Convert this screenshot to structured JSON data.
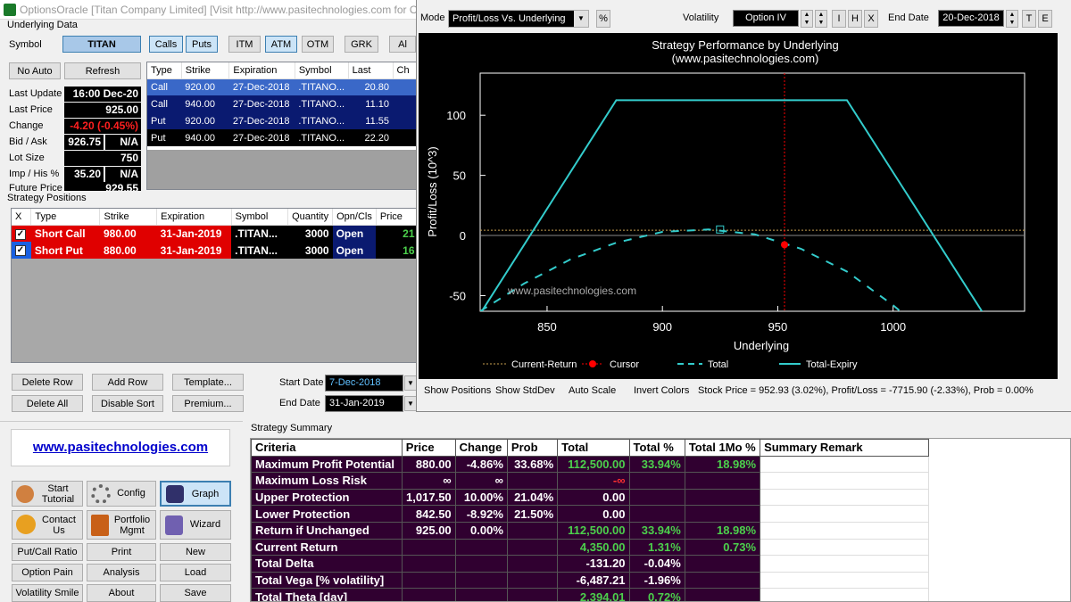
{
  "window": {
    "title": "OptionsOracle [Titan Company Limited]   [Visit  http://www.pasitechnologies.com  for O"
  },
  "underlying": {
    "group_label": "Underlying Data",
    "symbol_label": "Symbol",
    "symbol": "TITAN",
    "calls": "Calls",
    "puts": "Puts",
    "itm": "ITM",
    "atm": "ATM",
    "otm": "OTM",
    "grk": "GRK",
    "all": "Al",
    "no_auto": "No Auto",
    "refresh": "Refresh",
    "fields": [
      {
        "label": "Last Update",
        "value": "16:00 Dec-20"
      },
      {
        "label": "Last Price",
        "value": "925.00"
      },
      {
        "label": "Change",
        "value": "-4.20 (-0.45%)"
      },
      {
        "label": "Bid / Ask",
        "value": "926.75",
        "value2": "N/A"
      },
      {
        "label": "Lot Size",
        "value": "750"
      },
      {
        "label": "Imp / His %",
        "value": "35.20",
        "value2": "N/A"
      },
      {
        "label": "Future Price",
        "value": "929.55"
      }
    ]
  },
  "options_table": {
    "headers": [
      "Type",
      "Strike",
      "Expiration",
      "Symbol",
      "Last",
      "Ch"
    ],
    "rows": [
      {
        "type": "Call",
        "strike": "920.00",
        "expiration": "27-Dec-2018",
        "symbol": ".TITANO...",
        "last": "20.80"
      },
      {
        "type": "Call",
        "strike": "940.00",
        "expiration": "27-Dec-2018",
        "symbol": ".TITANO...",
        "last": "11.10"
      },
      {
        "type": "Put",
        "strike": "920.00",
        "expiration": "27-Dec-2018",
        "symbol": ".TITANO...",
        "last": "11.55"
      },
      {
        "type": "Put",
        "strike": "940.00",
        "expiration": "27-Dec-2018",
        "symbol": ".TITANO...",
        "last": "22.20"
      }
    ]
  },
  "positions": {
    "label": "Strategy Positions",
    "headers": [
      "X",
      "Type",
      "Strike",
      "Expiration",
      "Symbol",
      "Quantity",
      "Opn/Cls",
      "Price"
    ],
    "rows": [
      {
        "x": "✓",
        "type": "Short Call",
        "strike": "980.00",
        "expiration": "31-Jan-2019",
        "symbol": ".TITAN...",
        "quantity": "3000",
        "opn": "Open",
        "price": "21"
      },
      {
        "x": "✓",
        "type": "Short Put",
        "strike": "880.00",
        "expiration": "31-Jan-2019",
        "symbol": ".TITAN...",
        "quantity": "3000",
        "opn": "Open",
        "price": "16"
      }
    ]
  },
  "pos_buttons": {
    "delete_row": "Delete Row",
    "add_row": "Add Row",
    "template": "Template...",
    "delete_all": "Delete All",
    "disable_sort": "Disable Sort",
    "premium": "Premium...",
    "start_date_label": "Start Date",
    "start_date": "7-Dec-2018",
    "end_date_label": "End Date",
    "end_date": "31-Jan-2019"
  },
  "nav": {
    "link": "www.pasitechnologies.com",
    "start_tutorial": "Start Tutorial",
    "config": "Config",
    "graph": "Graph",
    "contact_us": "Contact Us",
    "portfolio": "Portfolio Mgmt",
    "wizard": "Wizard",
    "put_call_ratio": "Put/Call Ratio",
    "print": "Print",
    "new": "New",
    "option_pain": "Option Pain",
    "analysis": "Analysis",
    "load": "Load",
    "volatility_smile": "Volatility Smile",
    "about": "About",
    "save": "Save"
  },
  "summary": {
    "label": "Strategy Summary",
    "headers": [
      "Criteria",
      "Price",
      "Change",
      "Prob",
      "Total",
      "Total %",
      "Total 1Mo %",
      "Summary Remark"
    ],
    "rows": [
      [
        "Maximum Profit Potential",
        "880.00",
        "-4.86%",
        "33.68%",
        "112,500.00",
        "33.94%",
        "18.98%",
        ""
      ],
      [
        "Maximum Loss Risk",
        "∞",
        "∞",
        "",
        "-∞",
        "",
        "",
        ""
      ],
      [
        "Upper Protection",
        "1,017.50",
        "10.00%",
        "21.04%",
        "0.00",
        "",
        "",
        ""
      ],
      [
        "Lower Protection",
        "842.50",
        "-8.92%",
        "21.50%",
        "0.00",
        "",
        "",
        ""
      ],
      [
        "Return if Unchanged",
        "925.00",
        "0.00%",
        "",
        "112,500.00",
        "33.94%",
        "18.98%",
        ""
      ],
      [
        "Current Return",
        "",
        "",
        "",
        "4,350.00",
        "1.31%",
        "0.73%",
        ""
      ],
      [
        "Total Delta",
        "",
        "",
        "",
        "-131.20",
        "-0.04%",
        "",
        ""
      ],
      [
        "Total Vega [% volatility]",
        "",
        "",
        "",
        "-6,487.21",
        "-1.96%",
        "",
        ""
      ],
      [
        "Total Theta [day]",
        "",
        "",
        "",
        "2,394.01",
        "0.72%",
        "",
        ""
      ]
    ]
  },
  "graph": {
    "mode_label": "Mode",
    "mode": "Profit/Loss Vs. Underlying",
    "pct": "%",
    "vol_label": "Volatility",
    "vol": "Option IV",
    "i": "I",
    "h": "H",
    "x": "X",
    "end_label": "End Date",
    "end_date": "20-Dec-2018",
    "t": "T",
    "e": "E",
    "footer": {
      "show_positions": "Show Positions",
      "show_stddev": "Show StdDev",
      "auto_scale": "Auto Scale",
      "invert_colors": "Invert Colors",
      "status": "Stock Price = 952.93 (3.02%), Profit/Loss = -7715.90 (-2.33%), Prob = 0.00%"
    }
  },
  "chart_data": {
    "type": "line",
    "title": "Strategy Performance by Underlying",
    "subtitle": "(www.pasitechnologies.com)",
    "watermark": "www.pasitechnologies.com",
    "xlabel": "Underlying",
    "ylabel": "Profit/Loss (10^3)",
    "xlim": [
      821,
      1057
    ],
    "ylim": [
      -63,
      135
    ],
    "xticks": [
      850,
      900,
      950,
      1000
    ],
    "yticks": [
      -50,
      0,
      50,
      100
    ],
    "current_return": 4.35,
    "cursor": {
      "x": 952.93,
      "y": -7.72
    },
    "series": [
      {
        "name": "Total-Expiry",
        "color": "#33cccc",
        "dash": false,
        "x": [
          821,
          880,
          980,
          1057
        ],
        "y": [
          -65.1,
          112.5,
          112.5,
          -118.5
        ]
      },
      {
        "name": "Total",
        "color": "#33cccc",
        "dash": true,
        "x": [
          821,
          840,
          860,
          880,
          900,
          920,
          940,
          960,
          980,
          1000,
          1020,
          1040,
          1057
        ],
        "y": [
          -63,
          -40,
          -20,
          -6,
          3,
          5,
          1,
          -11,
          -30,
          -58,
          -90,
          -130,
          -170
        ]
      }
    ],
    "legend": [
      "Current-Return",
      "Cursor",
      "Total",
      "Total-Expiry"
    ],
    "legend_position": "bottom",
    "colors": {
      "bg": "#000000",
      "axes": "#ffffff",
      "current_return": "#c8a050",
      "cursor": "#ff0000",
      "line": "#33cccc"
    }
  }
}
